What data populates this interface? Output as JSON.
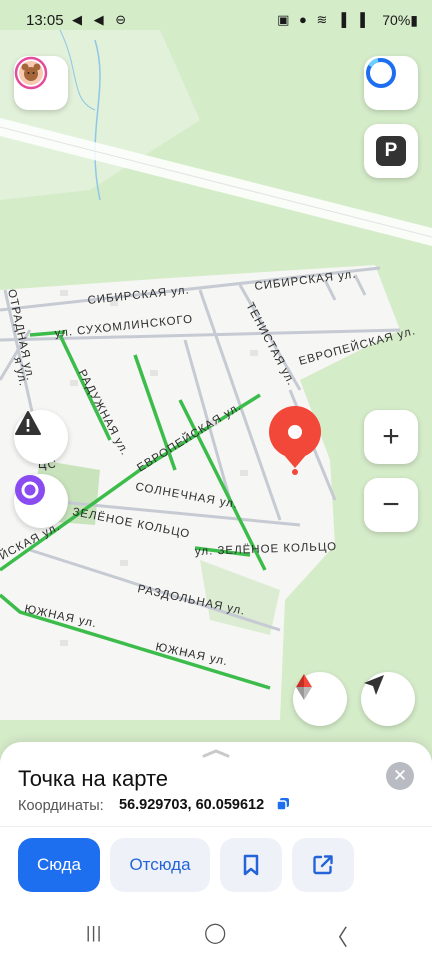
{
  "status_bar": {
    "time": "13:05",
    "left_icons": "◀ ◀ ⊖",
    "right_icons": "▣ ● ≋ ▐ ▐",
    "battery": "70%▮"
  },
  "map": {
    "streets": {
      "sibirskaya_1": "СИБИРСКАЯ ул.",
      "sibirskaya_2": "СИБИРСКАЯ ул.",
      "sukhomlinskogo": "ул. СУХОМЛИНСКОГО",
      "otradnaya": "ОТРАДНАЯ ул.",
      "tenistaya": "ТЕНИСТАЯ ул.",
      "evropeyskaya_1": "ЕВРОПЕЙСКАЯ ул.",
      "evropeyskaya_2": "ЕВРОПЕЙСКАЯ ул.",
      "raduzhnaya": "РАДУЖНАЯ ул.",
      "solnechnaya": "СОЛНЕЧНАЯ ул.",
      "zelenoe_1": "ЗЕЛЁНОЕ КОЛЬЦО",
      "zelenoe_2": "ул. ЗЕЛЁНОЕ КОЛЬЦО",
      "razdolnaya": "РАЗДОЛЬНАЯ ул.",
      "yuzhnaya_1": "ЮЖНАЯ ул.",
      "yuzhnaya_2": "ЮЖНАЯ ул.",
      "left_frag_1": "ЙСКАЯ ул.",
      "left_frag_2": "ЦС",
      "left_frag_3": "я ул."
    },
    "parking_label": "P",
    "zoom_in": "+",
    "zoom_out": "−"
  },
  "sheet": {
    "title": "Точка на карте",
    "coords_label": "Координаты:",
    "coords_value": "56.929703, 60.059612",
    "close": "✕",
    "buttons": {
      "here": "Сюда",
      "from": "Отсюда"
    }
  },
  "navbar": {
    "recents": "|||",
    "home": "◯",
    "back": "〈"
  },
  "colors": {
    "accent": "#1e6ef0",
    "marker": "#f2483a",
    "forest": "#d5ecc9",
    "road_green": "#3cbc4a"
  }
}
